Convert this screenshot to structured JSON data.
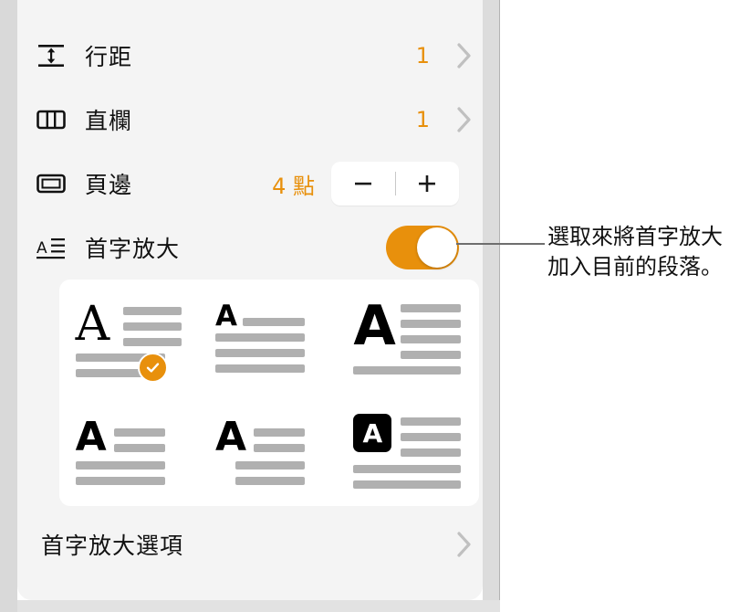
{
  "panel": {
    "rows": [
      {
        "icon": "line-spacing-icon",
        "label": "行距",
        "value": "1",
        "control": "chevron"
      },
      {
        "icon": "columns-icon",
        "label": "直欄",
        "value": "1",
        "control": "chevron"
      },
      {
        "icon": "margins-icon",
        "label": "頁邊",
        "value": "4 點",
        "control": "stepper",
        "minus_label": "−",
        "plus_label": "+"
      },
      {
        "icon": "drop-cap-icon",
        "label": "首字放大",
        "value": "",
        "control": "toggle",
        "toggle_state": "on"
      }
    ],
    "options_row": {
      "label": "首字放大選項"
    },
    "styles": [
      {
        "name": "drop-cap-style-1",
        "cap": "A",
        "cap_style": "serif",
        "selected": true,
        "badge": "checkmark"
      },
      {
        "name": "drop-cap-style-2",
        "cap": "A",
        "cap_style": "bold-small",
        "selected": false,
        "badge": ""
      },
      {
        "name": "drop-cap-style-3",
        "cap": "A",
        "cap_style": "bold-large",
        "selected": false,
        "badge": ""
      },
      {
        "name": "drop-cap-style-4",
        "cap": "A",
        "cap_style": "bold-medium",
        "selected": false,
        "badge": ""
      },
      {
        "name": "drop-cap-style-5",
        "cap": "A",
        "cap_style": "bold-medium-indent",
        "selected": false,
        "badge": ""
      },
      {
        "name": "drop-cap-style-6",
        "cap": "A",
        "cap_style": "reversed-box",
        "selected": false,
        "badge": ""
      }
    ]
  },
  "callout": {
    "line1": "選取來將首字放大",
    "line2": "加入目前的段落。"
  },
  "colors": {
    "accent_orange": "#e8900c",
    "panel_background": "#f4f4f4",
    "card_background": "#ffffff",
    "text_primary": "#111111",
    "placeholder_bar": "#b0b0b0",
    "chevron_gray": "#c0c0c0"
  }
}
